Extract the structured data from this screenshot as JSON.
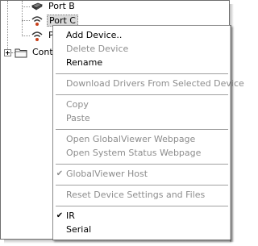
{
  "tree": {
    "items": [
      {
        "label": "Port B",
        "icon": "device-icon"
      },
      {
        "label": "Port C",
        "icon": "wireless-ir-icon",
        "selected": true
      },
      {
        "label": "P",
        "icon": "wireless-ir-icon"
      },
      {
        "label": "Cont",
        "icon": "folder-icon"
      }
    ]
  },
  "menu": {
    "items": [
      {
        "label": "Add Device..",
        "enabled": true,
        "checked": false
      },
      {
        "label": "Delete Device",
        "enabled": false,
        "checked": false
      },
      {
        "label": "Rename",
        "enabled": true,
        "checked": false
      },
      {
        "label": "Download Drivers From Selected Device",
        "enabled": false,
        "checked": false
      },
      {
        "label": "Copy",
        "enabled": false,
        "checked": false
      },
      {
        "label": "Paste",
        "enabled": false,
        "checked": false
      },
      {
        "label": "Open GlobalViewer Webpage",
        "enabled": false,
        "checked": false
      },
      {
        "label": "Open System Status Webpage",
        "enabled": false,
        "checked": false
      },
      {
        "label": "GlobalViewer Host",
        "enabled": false,
        "checked": true
      },
      {
        "label": "Reset Device Settings and Files",
        "enabled": false,
        "checked": false
      },
      {
        "label": "IR",
        "enabled": true,
        "checked": true
      },
      {
        "label": "Serial",
        "enabled": true,
        "checked": false
      }
    ],
    "check_glyph": "✔"
  },
  "colors": {
    "disabled_text": "#8d8d8d",
    "selection_bg": "#d9d9d9",
    "ir_icon_accent": "#c8401a"
  }
}
